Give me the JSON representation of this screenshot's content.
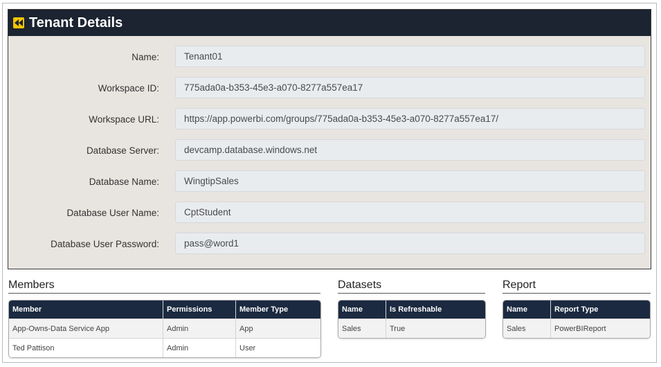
{
  "header": {
    "title": "Tenant Details",
    "back_icon": "rewind-icon",
    "accent": "#f5c400"
  },
  "fields": [
    {
      "label": "Name:",
      "value": "Tenant01"
    },
    {
      "label": "Workspace ID:",
      "value": "775ada0a-b353-45e3-a070-8277a557ea17"
    },
    {
      "label": "Workspace URL:",
      "value": "https://app.powerbi.com/groups/775ada0a-b353-45e3-a070-8277a557ea17/"
    },
    {
      "label": "Database Server:",
      "value": "devcamp.database.windows.net"
    },
    {
      "label": "Database Name:",
      "value": "WingtipSales"
    },
    {
      "label": "Database User Name:",
      "value": "CptStudent"
    },
    {
      "label": "Database User Password:",
      "value": "pass@word1"
    }
  ],
  "members": {
    "title": "Members",
    "columns": [
      "Member",
      "Permissions",
      "Member Type"
    ],
    "rows": [
      [
        "App-Owns-Data Service App",
        "Admin",
        "App"
      ],
      [
        "Ted Pattison",
        "Admin",
        "User"
      ]
    ]
  },
  "datasets": {
    "title": "Datasets",
    "columns": [
      "Name",
      "Is Refreshable"
    ],
    "rows": [
      [
        "Sales",
        "True"
      ]
    ]
  },
  "report": {
    "title": "Report",
    "columns": [
      "Name",
      "Report Type"
    ],
    "rows": [
      [
        "Sales",
        "PowerBIReport"
      ]
    ]
  },
  "colors": {
    "header_bg": "#1b2430",
    "panel_bg": "#e8e4df",
    "table_header_bg": "#1b2a40"
  }
}
